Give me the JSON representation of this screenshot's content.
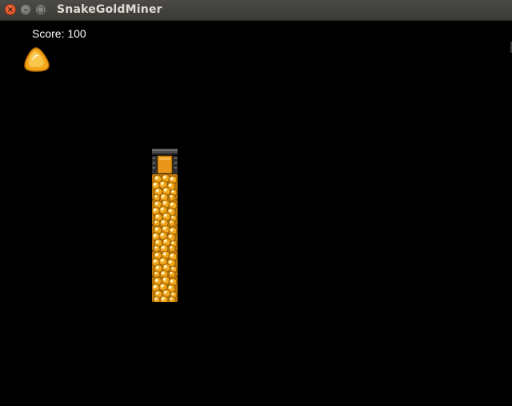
{
  "window": {
    "title": "SnakeGoldMiner",
    "close_glyph": "×",
    "minimize_glyph": "–",
    "maximize_glyph": "□"
  },
  "hud": {
    "score_text": "Score: 100"
  },
  "game": {
    "food_icon": "gold-nugget-icon",
    "snake_head_icon": "mining-cart-icon",
    "snake_body_icon": "gold-ore-block-icon",
    "snake_length": 6,
    "colors": {
      "background": "#000000",
      "gold": "#f2a71b",
      "gold_dark": "#b86b00",
      "head_metal": "#3a3a3a"
    }
  }
}
